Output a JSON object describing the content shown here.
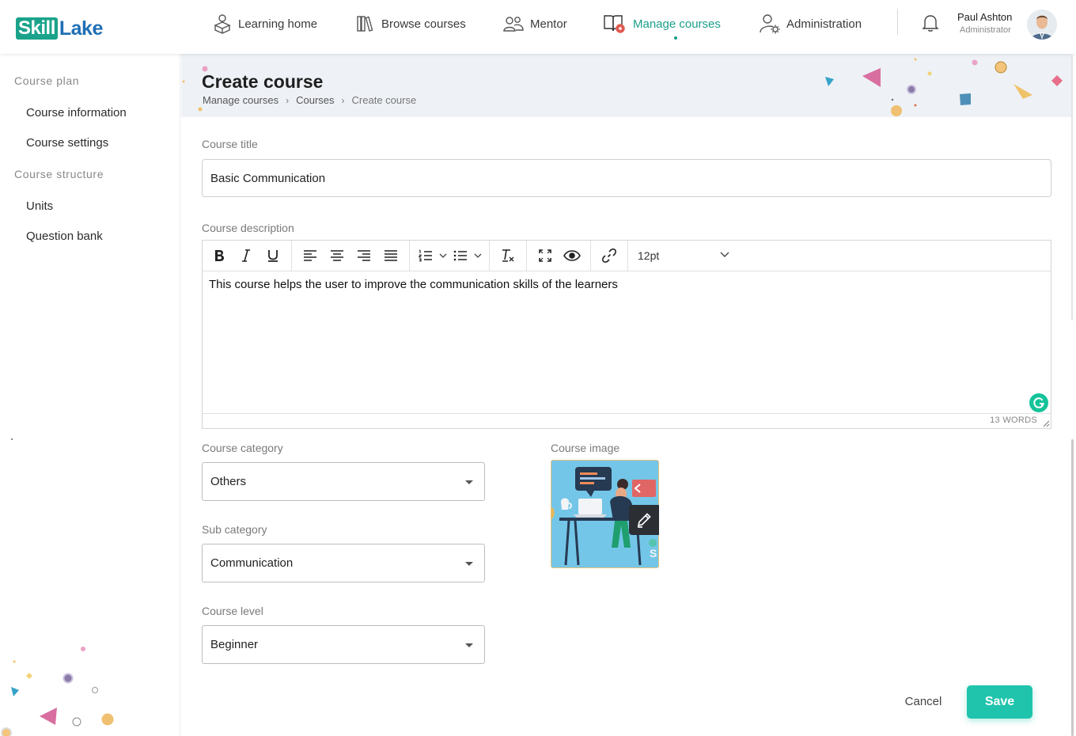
{
  "brand": {
    "part1": "Skill",
    "part2": "Lake"
  },
  "nav": {
    "items": [
      {
        "label": "Learning home",
        "icon": "learning-home-icon",
        "active": false
      },
      {
        "label": "Browse courses",
        "icon": "books-icon",
        "active": false
      },
      {
        "label": "Mentor",
        "icon": "mentor-icon",
        "active": false
      },
      {
        "label": "Manage courses",
        "icon": "manage-courses-icon",
        "active": true
      },
      {
        "label": "Administration",
        "icon": "admin-gear-icon",
        "active": false
      }
    ]
  },
  "user": {
    "name": "Paul Ashton",
    "role": "Administrator"
  },
  "sidebar": {
    "sections": [
      {
        "heading": "Course plan",
        "items": [
          "Course information",
          "Course settings"
        ]
      },
      {
        "heading": "Course structure",
        "items": [
          "Units",
          "Question bank"
        ]
      }
    ]
  },
  "page": {
    "title": "Create course",
    "breadcrumb": [
      "Manage courses",
      "Courses",
      "Create course"
    ]
  },
  "form": {
    "title_label": "Course title",
    "title_value": "Basic Communication",
    "description_label": "Course description",
    "description_text": "This course helps the user to improve the communication skills of the learners",
    "font_size": "12pt",
    "word_count": "13 WORDS",
    "category_label": "Course category",
    "category_value": "Others",
    "subcategory_label": "Sub category",
    "subcategory_value": "Communication",
    "level_label": "Course level",
    "level_value": "Beginner",
    "image_label": "Course image"
  },
  "actions": {
    "cancel": "Cancel",
    "save": "Save"
  },
  "colors": {
    "accent": "#20c4ad",
    "active_nav": "#1a9e88",
    "brand_blue": "#1f6fb5",
    "header_band": "#eef1f6"
  }
}
